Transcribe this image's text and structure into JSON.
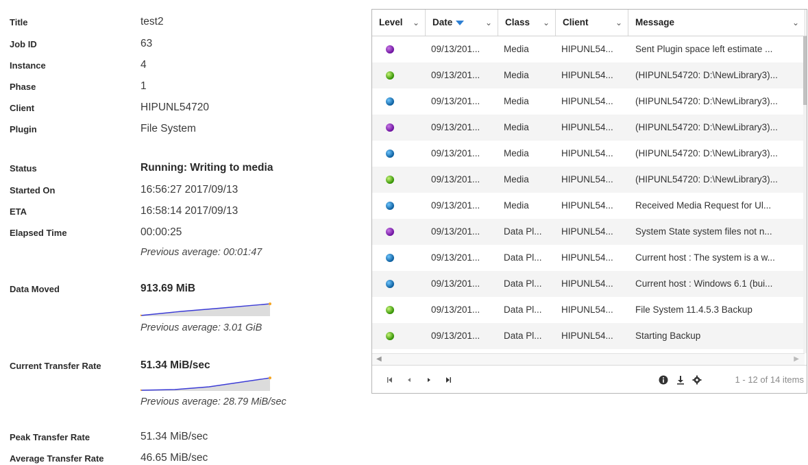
{
  "details": {
    "title": {
      "label": "Title",
      "value": "test2"
    },
    "job_id": {
      "label": "Job ID",
      "value": "63"
    },
    "instance": {
      "label": "Instance",
      "value": "4"
    },
    "phase": {
      "label": "Phase",
      "value": "1"
    },
    "client": {
      "label": "Client",
      "value": "HIPUNL54720"
    },
    "plugin": {
      "label": "Plugin",
      "value": "File System"
    },
    "status": {
      "label": "Status",
      "value": "Running: Writing to media"
    },
    "started_on": {
      "label": "Started On",
      "value": "16:56:27 2017/09/13"
    },
    "eta": {
      "label": "ETA",
      "value": "16:58:14 2017/09/13"
    },
    "elapsed_time": {
      "label": "Elapsed Time",
      "value": "00:00:25",
      "previous": "Previous average: 00:01:47"
    },
    "data_moved": {
      "label": "Data Moved",
      "value": "913.69 MiB",
      "previous": "Previous average: 3.01 GiB"
    },
    "current_transfer_rate": {
      "label": "Current Transfer Rate",
      "value": "51.34 MiB/sec",
      "previous": "Previous average: 28.79 MiB/sec"
    },
    "peak_transfer_rate": {
      "label": "Peak Transfer Rate",
      "value": "51.34 MiB/sec"
    },
    "average_transfer_rate": {
      "label": "Average Transfer Rate",
      "value": "46.65 MiB/sec"
    }
  },
  "colors": {
    "sparkline_line": "#3b3bd6",
    "sparkline_fill": "#dcdcdc",
    "sparkline_endpoint": "#f5a623",
    "sort_arrow": "#2d7fd3",
    "level_purple": "#7b1fa2",
    "level_green": "#43a000",
    "level_blue": "#0a6fb8"
  },
  "grid": {
    "columns": {
      "level": "Level",
      "date": "Date",
      "class": "Class",
      "client": "Client",
      "message": "Message"
    },
    "sorted_column": "Date",
    "sort_direction": "descending",
    "rows": [
      {
        "level": "purple",
        "date": "09/13/201...",
        "class": "Media",
        "client": "HIPUNL54...",
        "message": "Sent Plugin space left estimate ..."
      },
      {
        "level": "green",
        "date": "09/13/201...",
        "class": "Media",
        "client": "HIPUNL54...",
        "message": "(HIPUNL54720: D:\\NewLibrary3)..."
      },
      {
        "level": "blue",
        "date": "09/13/201...",
        "class": "Media",
        "client": "HIPUNL54...",
        "message": "(HIPUNL54720: D:\\NewLibrary3)..."
      },
      {
        "level": "purple",
        "date": "09/13/201...",
        "class": "Media",
        "client": "HIPUNL54...",
        "message": "(HIPUNL54720: D:\\NewLibrary3)..."
      },
      {
        "level": "blue",
        "date": "09/13/201...",
        "class": "Media",
        "client": "HIPUNL54...",
        "message": "(HIPUNL54720: D:\\NewLibrary3)..."
      },
      {
        "level": "green",
        "date": "09/13/201...",
        "class": "Media",
        "client": "HIPUNL54...",
        "message": "(HIPUNL54720: D:\\NewLibrary3)..."
      },
      {
        "level": "blue",
        "date": "09/13/201...",
        "class": "Media",
        "client": "HIPUNL54...",
        "message": "Received Media Request for Ul..."
      },
      {
        "level": "purple",
        "date": "09/13/201...",
        "class": "Data Pl...",
        "client": "HIPUNL54...",
        "message": "System State system files not n..."
      },
      {
        "level": "blue",
        "date": "09/13/201...",
        "class": "Data Pl...",
        "client": "HIPUNL54...",
        "message": "Current host : The system is a w..."
      },
      {
        "level": "blue",
        "date": "09/13/201...",
        "class": "Data Pl...",
        "client": "HIPUNL54...",
        "message": "Current host : Windows 6.1 (bui..."
      },
      {
        "level": "green",
        "date": "09/13/201...",
        "class": "Data Pl...",
        "client": "HIPUNL54...",
        "message": "File System 11.4.5.3 Backup"
      },
      {
        "level": "green",
        "date": "09/13/201...",
        "class": "Data Pl...",
        "client": "HIPUNL54...",
        "message": "Starting Backup"
      }
    ],
    "pager": {
      "info": "1 - 12 of 14 items",
      "icons": [
        "first-page-icon",
        "previous-page-icon",
        "next-page-icon",
        "last-page-icon",
        "info-icon",
        "download-icon",
        "settings-icon"
      ]
    }
  }
}
